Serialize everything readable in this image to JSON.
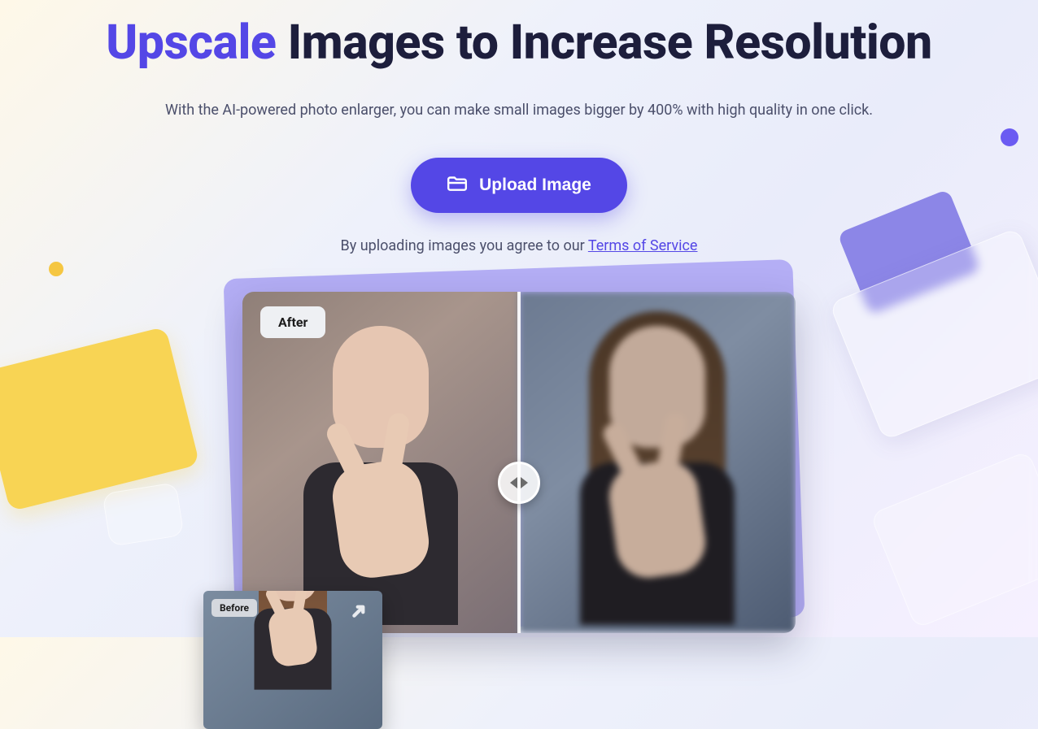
{
  "hero": {
    "title_accent": "Upscale",
    "title_rest": "Images to Increase Resolution",
    "subtitle": "With the AI-powered photo enlarger, you can make small images bigger by 400% with high quality in one click."
  },
  "upload": {
    "button_label": "Upload Image",
    "tos_prefix": "By uploading images you agree to our ",
    "tos_link_label": "Terms of Service"
  },
  "compare": {
    "after_label": "After",
    "before_label": "Before"
  },
  "colors": {
    "accent": "#5447e6"
  }
}
